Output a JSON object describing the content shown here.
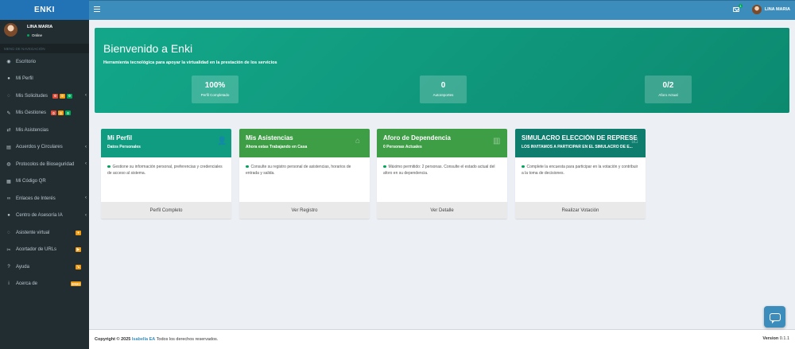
{
  "app": {
    "logo": "ENKI"
  },
  "topbar": {
    "mail_badge": "1",
    "user_name": "LINA MARIA"
  },
  "sidebar": {
    "user_name": "LINA MARIA",
    "status": "Online",
    "section_header": "MENÚ DE NAVEGACIÓN",
    "items": [
      {
        "label": "Escritorio",
        "icon": "dashboard-icon",
        "glyph": "◉"
      },
      {
        "label": "Mi Perfil",
        "icon": "user-icon",
        "glyph": "●"
      },
      {
        "label": "Mis Solicitudes",
        "icon": "chat-icon",
        "glyph": "◌",
        "badges": [
          {
            "text": "0",
            "color": "red"
          },
          {
            "text": "0",
            "color": "orange"
          },
          {
            "text": "0",
            "color": "green"
          }
        ],
        "chevron": true
      },
      {
        "label": "Mis Gestiones",
        "icon": "wrench-icon",
        "glyph": "✎",
        "badges": [
          {
            "text": "0",
            "color": "red"
          },
          {
            "text": "0",
            "color": "orange"
          },
          {
            "text": "0",
            "color": "green"
          }
        ]
      },
      {
        "label": "Mis Asistencias",
        "icon": "exchange-icon",
        "glyph": "⇄"
      },
      {
        "label": "Acuerdos y Circulares",
        "icon": "file-icon",
        "glyph": "▤",
        "chevron": true
      },
      {
        "label": "Protocolos de Bioseguridad",
        "icon": "shield-icon",
        "glyph": "◍",
        "chevron": true
      },
      {
        "label": "Mi Código QR",
        "icon": "qr-icon",
        "glyph": "▦"
      },
      {
        "label": "Enlaces de Interés",
        "icon": "link-icon",
        "glyph": "∞",
        "chevron": true
      },
      {
        "label": "Centro de Asesoría IA",
        "icon": "comment-icon",
        "glyph": "●",
        "chevron": true
      },
      {
        "label": "Asistente virtual",
        "icon": "robot-icon",
        "glyph": "◌",
        "badge_right": {
          "text": "●",
          "color": "orange"
        }
      },
      {
        "label": "Acortador de URLs",
        "icon": "scissors-icon",
        "glyph": "✂",
        "badge_right": {
          "text": "▶",
          "color": "orange"
        }
      },
      {
        "label": "Ayuda",
        "icon": "help-icon",
        "glyph": "?",
        "badge_right": {
          "text": "↘",
          "color": "orange"
        }
      },
      {
        "label": "Acerca de",
        "icon": "info-icon",
        "glyph": "i",
        "badge_right": {
          "text": "ENKI",
          "color": "orange"
        }
      }
    ]
  },
  "hero": {
    "title": "Bienvenido a Enki",
    "subtitle": "Herramienta tecnológica para apoyar la virtualidad en la prestación de los servicios",
    "stats": [
      {
        "value": "100%",
        "label": "Perfil Completado"
      },
      {
        "value": "0",
        "label": "Autoreportes"
      },
      {
        "value": "0/2",
        "label": "Aforo Actual"
      }
    ]
  },
  "cards": [
    {
      "title": "Mi Perfil",
      "subtitle": "Datos Personales",
      "icon": "user-icon",
      "glyph": "👤",
      "color": "#0f9c80",
      "body": "Gestione su información personal, preferencias y credenciales de acceso al sistema.",
      "footer": "Perfil Completo"
    },
    {
      "title": "Mis Asistencias",
      "subtitle": "Ahora estas Trabajando en Casa",
      "icon": "home-icon",
      "glyph": "⌂",
      "color": "#3e9e45",
      "body": "Consulte su registro personal de asistencias, horarios de entrada y salida.",
      "footer": "Ver Registro"
    },
    {
      "title": "Aforo de Dependencia",
      "subtitle": "0 Personas Actuales",
      "icon": "building-icon",
      "glyph": "▥",
      "color": "#3e9e45",
      "body": "Máximo permitido: 2 personas. Consulte el estado actual del aforo en su dependencia.",
      "footer": "Ver Detalle"
    },
    {
      "title": "SIMULACRO ELECCIÓN DE REPRESEN...",
      "subtitle": "LOS INVITAMOS A PARTICIPAR EN EL SIMULACRO DE E...",
      "icon": "vote-icon",
      "glyph": "☑",
      "color": "#0e7d6e",
      "body": "Complete la encuesta para participar en la votación y contribuir a la toma de decisiones.",
      "footer": "Realizar Votación"
    }
  ],
  "footer": {
    "copyright_prefix": "Copyright © 2025",
    "brand": "Isabella EA",
    "rights": "Todos los derechos reservados.",
    "version_label": "Version",
    "version": "0.1.1"
  },
  "colors": {
    "sidebar": "#222d32",
    "topbar": "#3c8dbc",
    "logo": "#2173b6",
    "hero": "#0f9c80",
    "green": "#3e9e45"
  }
}
